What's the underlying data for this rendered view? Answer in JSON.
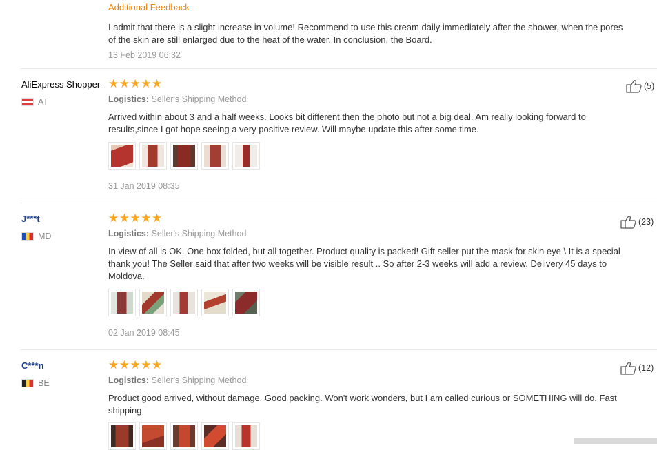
{
  "top_review": {
    "additional_label": "Additional Feedback",
    "text_lines": [
      "I admit that there is a slight increase in volume! Recommend to use this cream daily immediately after the shower, when the pores",
      "of the skin are still enlarged due to the heat of the water. In conclusion, the Board."
    ],
    "date": "13 Feb 2019 06:32"
  },
  "reviews": [
    {
      "name": "AliExpress Shopper",
      "country": "AT",
      "stars": "★★★★★",
      "logistics_label": "Logistics:",
      "logistics_value": "Seller's Shipping Method",
      "text_lines": [
        "Arrived within about 3 and a half weeks. Looks bit different then the photo but not a big deal. Am really looking forward to",
        "results,since I got hope seeing a very positive review. Will maybe update this after some time."
      ],
      "date": "31 Jan 2019 08:35",
      "likes": "(5)"
    },
    {
      "name": "J***t",
      "country": "MD",
      "stars": "★★★★★",
      "logistics_label": "Logistics:",
      "logistics_value": "Seller's Shipping Method",
      "text_lines": [
        "In view of all is OK. One box folded, but all together. Product quality is packed! Gift seller put the mask for skin eye \\ It is a special",
        "thank you! The Seller said that after two weeks will be visible result .. So after 2-3 weeks will add a review. Delivery 45 days to",
        "Moldova."
      ],
      "date": "02 Jan 2019 08:45",
      "likes": "(23)"
    },
    {
      "name": "C***n",
      "country": "BE",
      "stars": "★★★★★",
      "logistics_label": "Logistics:",
      "logistics_value": "Seller's Shipping Method",
      "text_lines": [
        "Product good arrived, without damage. Good packing. Won't work wonders, but I am called curious or SOMETHING will do. Fast",
        "shipping"
      ],
      "likes": "(12)"
    }
  ],
  "colors": {
    "star": "#f6a623",
    "additional_feedback": "#f08200",
    "name_link": "#1b3e8e",
    "separator": "#e8e8e8"
  },
  "icons": [
    "thumbs-up-icon",
    "flag-icon",
    "product-photo-thumbnail"
  ]
}
